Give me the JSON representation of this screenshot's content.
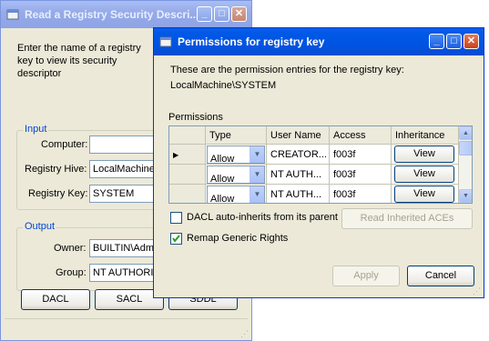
{
  "back_window": {
    "title": "Read a Registry Security Descri...",
    "intro": "Enter the name of a registry\nkey to view its security\ndescriptor",
    "input_group": "Input",
    "computer_label": "Computer:",
    "computer_value": "",
    "hive_label": "Registry Hive:",
    "hive_value": "LocalMachine",
    "key_label": "Registry Key:",
    "key_value": "SYSTEM",
    "output_group": "Output",
    "owner_label": "Owner:",
    "owner_value": "BUILTIN\\Adm",
    "group_label": "Group:",
    "group_value": "NT AUTHORI",
    "buttons": [
      "DACL",
      "SACL",
      "SDDL"
    ]
  },
  "dialog": {
    "title": "Permissions for registry key",
    "description": "These are the permission entries for the registry key:",
    "key_path": "LocalMachine\\SYSTEM",
    "permissions_label": "Permissions",
    "columns": [
      "Type",
      "User Name",
      "Access",
      "Inheritance"
    ],
    "rows": [
      {
        "type": "Allow",
        "user": "CREATOR...",
        "access": "f003f",
        "inheritance": "View"
      },
      {
        "type": "Allow",
        "user": "NT AUTH...",
        "access": "f003f",
        "inheritance": "View"
      },
      {
        "type": "Allow",
        "user": "NT AUTH...",
        "access": "f003f",
        "inheritance": "View"
      }
    ],
    "dacl_autoinherits_label": "DACL auto-inherits from its parent",
    "dacl_autoinherits_checked": false,
    "read_inherited_label": "Read Inherited ACEs",
    "remap_label": "Remap Generic Rights",
    "remap_checked": true,
    "apply_label": "Apply",
    "cancel_label": "Cancel"
  },
  "colors": {
    "active_title": "#0054e3",
    "inactive_title": "#97abe9",
    "group_label": "#0046d5",
    "selection": "#316ac5"
  }
}
